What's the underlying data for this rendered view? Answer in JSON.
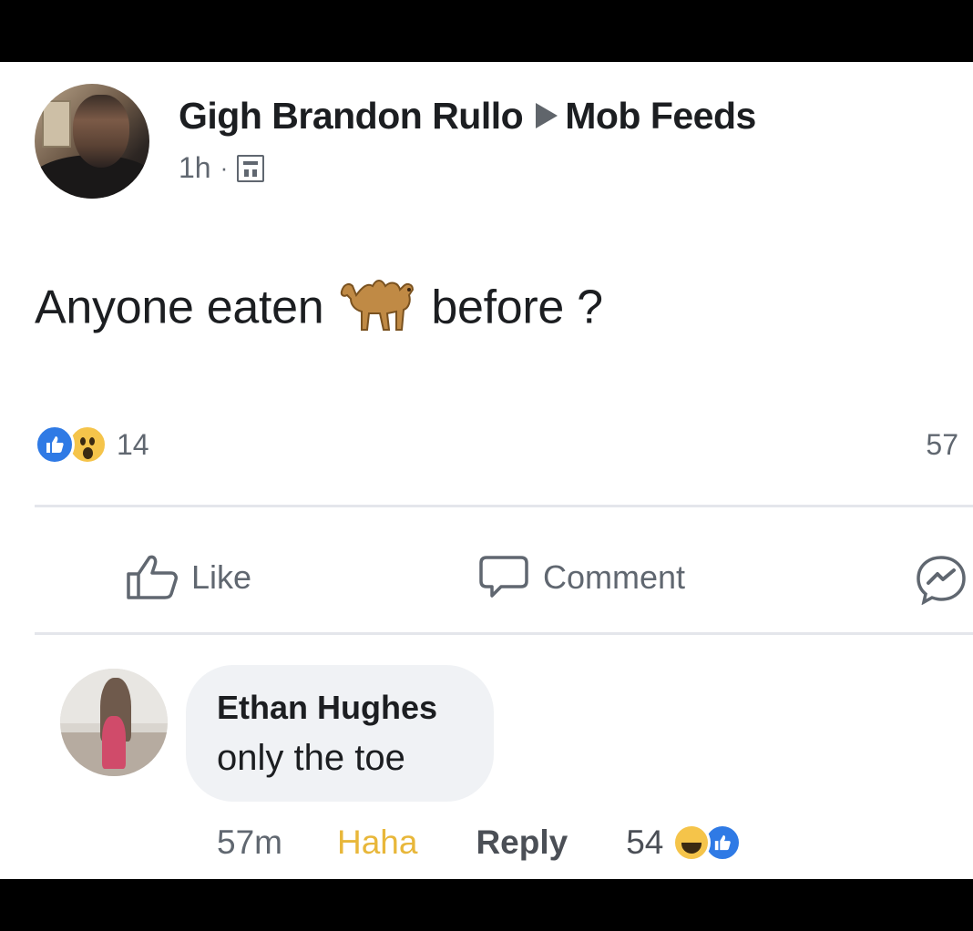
{
  "post": {
    "author": "Gigh Brandon Rullo",
    "group": "Mob Feeds",
    "time": "1h",
    "separator": "·",
    "text_before": "Anyone eaten",
    "emoji": "camel",
    "text_after": "before ?",
    "reaction_count": "14",
    "comment_count": "57"
  },
  "actions": {
    "like_label": "Like",
    "comment_label": "Comment"
  },
  "comment": {
    "author": "Ethan Hughes",
    "text": "only the toe",
    "time": "57m",
    "reaction_label": "Haha",
    "reply_label": "Reply",
    "reaction_count": "54"
  },
  "colors": {
    "reaction_haha": "#e8b73a",
    "like_blue": "#2f7ae5",
    "muted_text": "#606770"
  },
  "icons": [
    "page-icon",
    "camel-emoji-icon",
    "like-reaction-icon",
    "wow-reaction-icon",
    "thumbs-up-icon",
    "comment-bubble-icon",
    "messenger-icon",
    "haha-reaction-icon"
  ]
}
